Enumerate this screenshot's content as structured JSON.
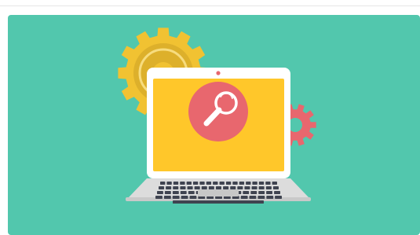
{
  "illustration": {
    "subject": "laptop-with-magnifier",
    "icons": [
      "large-gear-icon",
      "small-gear-icon",
      "magnifier-icon",
      "keyboard-icon",
      "trackpad-icon",
      "webcam-icon"
    ],
    "colors": {
      "background": "#52c7ad",
      "gear_large": "#f1c232",
      "gear_large_dark": "#ddb02b",
      "gear_small": "#e8676e",
      "screen": "#ffc72a",
      "laptop_frame": "#ffffff",
      "laptop_base": "#dcdcdc",
      "keys": "#3f4350",
      "magnifier_badge": "#e8676e",
      "webcam": "#e8676e"
    }
  }
}
